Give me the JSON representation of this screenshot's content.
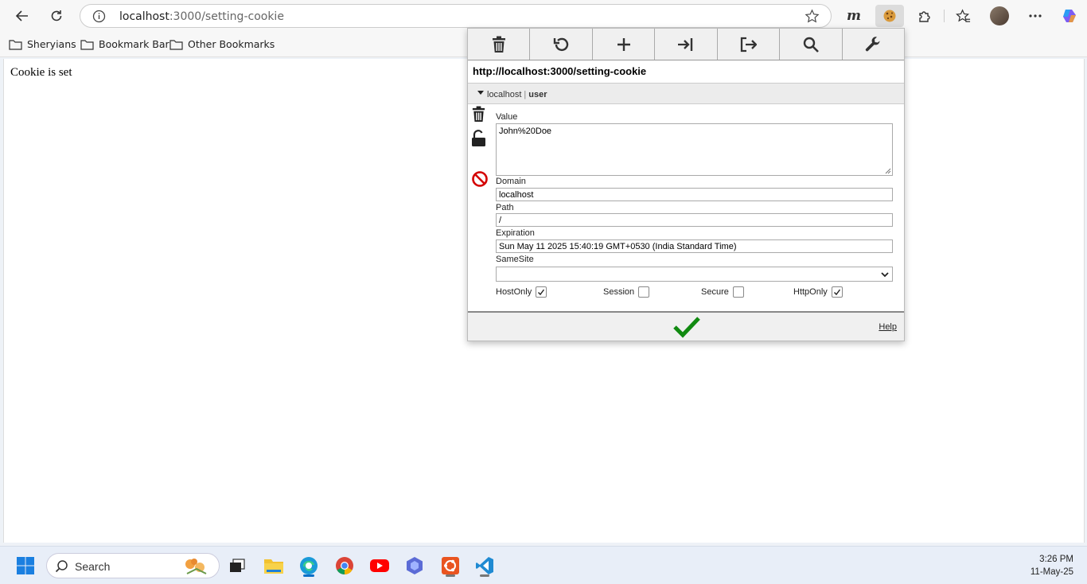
{
  "browser": {
    "url_host": "localhost",
    "url_rest": ":3000/setting-cookie",
    "profile_initial": "m"
  },
  "bookmarks": [
    {
      "label": "Sheryians"
    },
    {
      "label": "Bookmark Bar"
    },
    {
      "label": "Other Bookmarks"
    }
  ],
  "page": {
    "text": "Cookie is set"
  },
  "cookie_editor": {
    "url": "http://localhost:3000/setting-cookie",
    "domain_header": "localhost",
    "separator": "|",
    "cookie_name": "user",
    "labels": {
      "value": "Value",
      "domain": "Domain",
      "path": "Path",
      "expiration": "Expiration",
      "samesite": "SameSite",
      "hostonly": "HostOnly",
      "session": "Session",
      "secure": "Secure",
      "httponly": "HttpOnly",
      "help": "Help"
    },
    "values": {
      "value": "John%20Doe",
      "domain": "localhost",
      "path": "/",
      "expiration": "Sun May 11 2025 15:40:19 GMT+0530 (India Standard Time)",
      "samesite": ""
    },
    "flags": {
      "hostonly": true,
      "session": false,
      "secure": false,
      "httponly": true
    },
    "toolbar_icons": [
      "trash-icon",
      "undo-icon",
      "plus-icon",
      "import-icon",
      "export-icon",
      "search-icon",
      "wrench-icon"
    ]
  },
  "taskbar": {
    "search_label": "Search",
    "time": "3:26 PM",
    "date": "11-May-25"
  }
}
